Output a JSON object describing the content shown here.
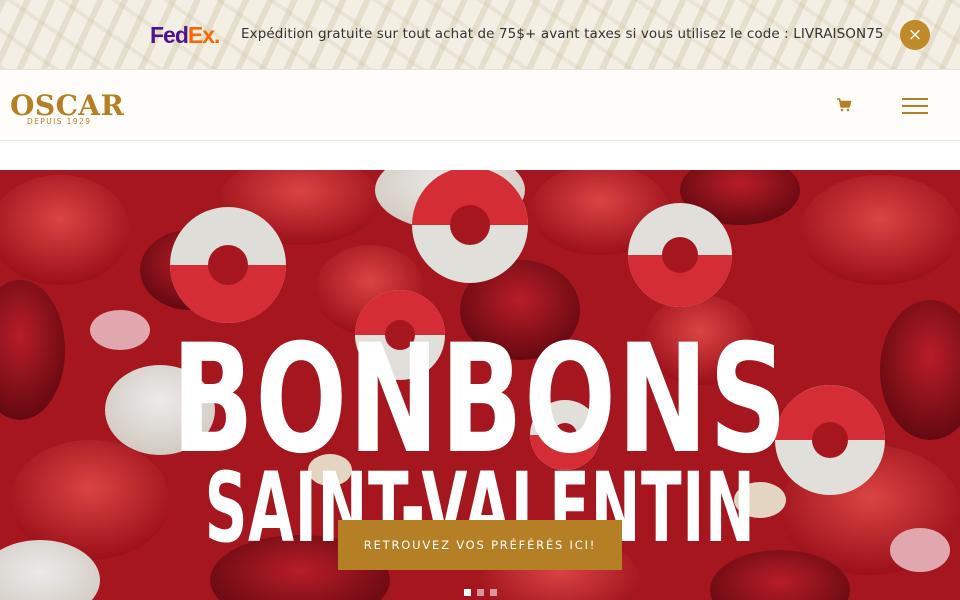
{
  "promo": {
    "carrier_logo_fed": "Fed",
    "carrier_logo_ex": "Ex.",
    "message": "Expédition gratuite sur tout achat de 75$+ avant taxes si vous utilisez le code : LIVRAISON75",
    "close_label": "×"
  },
  "header": {
    "brand_name": "OSCAR",
    "brand_tagline": "DEPUIS 1929",
    "cart_icon": "cart-icon",
    "menu_icon": "hamburger-menu-icon"
  },
  "hero": {
    "title": "BONBONS",
    "subtitle": "SAINT-VALENTIN",
    "cta_label": "RETROUVEZ VOS PRÉFÉRÉS ICI!",
    "slides_count": 3,
    "active_slide": 1
  },
  "colors": {
    "accent_gold": "#b57f25",
    "close_button": "#c08a2a",
    "fedex_purple": "#4d148c",
    "fedex_orange": "#ff6600",
    "hero_red": "#c21d2a"
  }
}
